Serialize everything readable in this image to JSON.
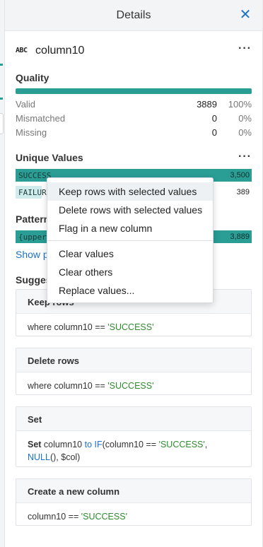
{
  "header": {
    "title": "Details",
    "close_glyph": "✕"
  },
  "column": {
    "type_icon": "ABC",
    "name": "column10",
    "more": "···"
  },
  "quality": {
    "title": "Quality",
    "bar_color": "#2a9d95",
    "rows": [
      {
        "label": "Valid",
        "count": "3889",
        "percent": "100%"
      },
      {
        "label": "Mismatched",
        "count": "0",
        "percent": "0%"
      },
      {
        "label": "Missing",
        "count": "0",
        "percent": "0%"
      }
    ]
  },
  "unique_values": {
    "title": "Unique Values",
    "more": "···",
    "items": [
      {
        "label": "SUCCESS",
        "count": "3,500",
        "fraction": 1.0
      },
      {
        "label": "FAILURE",
        "count": "389",
        "fraction": 0.11
      }
    ]
  },
  "patterns": {
    "title": "Patterns",
    "items": [
      {
        "label": "{upper}+",
        "count": "3,889",
        "fraction": 1.0
      }
    ],
    "show_link": "Show patterns"
  },
  "suggestions": {
    "title": "Suggestions",
    "cards": [
      {
        "title": "Keep rows",
        "prefix": "where column10 == ",
        "value": "'SUCCESS'"
      },
      {
        "title": "Delete rows",
        "prefix": "where column10 == ",
        "value": "'SUCCESS'"
      },
      {
        "title": "Set",
        "kw": "Set",
        "t1": " column10 ",
        "to": "to",
        "fn1": "IF",
        "t2": "(column10 == ",
        "value": "'SUCCESS'",
        "t3": ",",
        "fn2": "NULL",
        "t4": "(), $col)"
      },
      {
        "title": "Create a new column",
        "prefix": "column10 == ",
        "value": "'SUCCESS'"
      }
    ]
  },
  "context_menu": {
    "items_group1": [
      "Keep rows with selected values",
      "Delete rows with selected values",
      "Flag in a new column"
    ],
    "items_group2": [
      "Clear values",
      "Clear others",
      "Replace values..."
    ]
  },
  "colors": {
    "accent": "#2a9d95",
    "link": "#1a73c8",
    "string": "#2e8b2e"
  }
}
